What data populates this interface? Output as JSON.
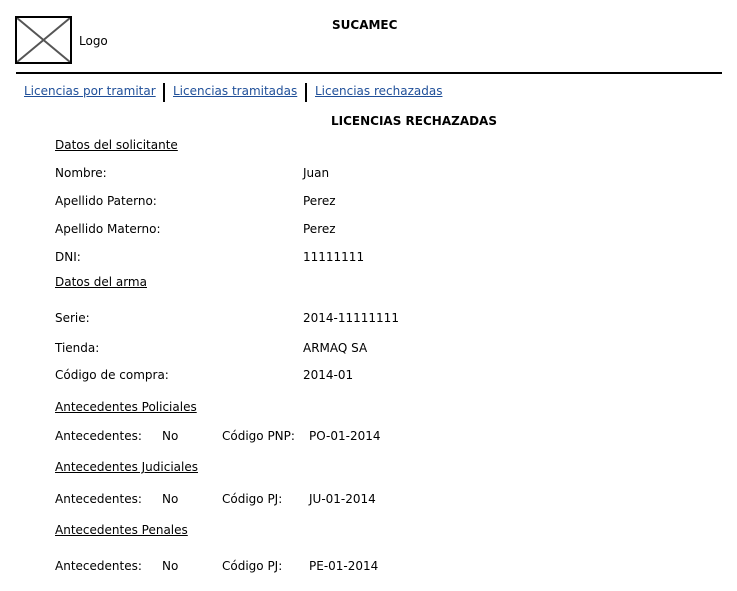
{
  "header": {
    "logo_label": "Logo",
    "app_title": "SUCAMEC"
  },
  "nav": {
    "items": [
      {
        "label": "Licencias por tramitar"
      },
      {
        "label": "Licencias tramitadas"
      },
      {
        "label": "Licencias rechazadas"
      }
    ]
  },
  "page_title": "LICENCIAS RECHAZADAS",
  "solicitante": {
    "heading": "Datos del solicitante",
    "fields": [
      {
        "label": "Nombre:",
        "value": "Juan"
      },
      {
        "label": "Apellido Paterno:",
        "value": "Perez"
      },
      {
        "label": "Apellido Materno:",
        "value": "Perez"
      },
      {
        "label": "DNI:",
        "value": "11111111"
      }
    ]
  },
  "arma": {
    "heading": "Datos del arma",
    "fields": [
      {
        "label": "Serie:",
        "value": "2014-11111111"
      },
      {
        "label": "Tienda:",
        "value": "ARMAQ SA"
      },
      {
        "label": "Código de compra:",
        "value": "2014-01"
      }
    ]
  },
  "antecedentes": [
    {
      "heading": "Antecedentes Policiales",
      "label": "Antecedentes:",
      "value": "No",
      "code_label": "Código PNP:",
      "code_value": "PO-01-2014"
    },
    {
      "heading": "Antecedentes Judiciales",
      "label": "Antecedentes:",
      "value": "No",
      "code_label": "Código PJ:",
      "code_value": "JU-01-2014"
    },
    {
      "heading": "Antecedentes Penales",
      "label": "Antecedentes:",
      "value": "No",
      "code_label": "Código PJ:",
      "code_value": "PE-01-2014"
    }
  ]
}
